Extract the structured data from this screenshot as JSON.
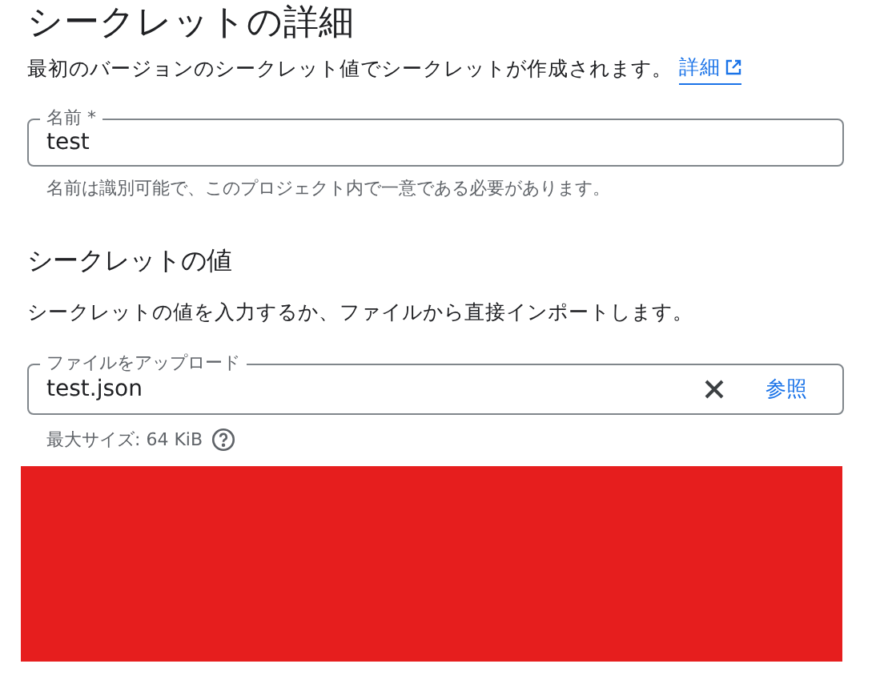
{
  "title": "シークレットの詳細",
  "description": {
    "text": "最初のバージョンのシークレット値でシークレットが作成されます。",
    "link": "詳細"
  },
  "name_field": {
    "label": "名前 *",
    "value": "test",
    "hint": "名前は識別可能で、このプロジェクト内で一意である必要があります。"
  },
  "secret_value": {
    "heading": "シークレットの値",
    "description": "シークレットの値を入力するか、ファイルから直接インポートします。",
    "upload_field": {
      "label": "ファイルをアップロード",
      "value": "test.json",
      "browse_button": "参照"
    },
    "max_size": "最大サイズ: 64 KiB"
  }
}
